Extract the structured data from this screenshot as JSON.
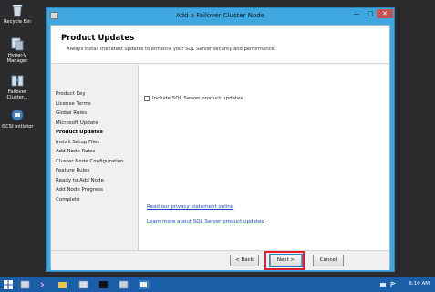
{
  "window": {
    "title": "Add a Failover Cluster Node",
    "minimize_glyph": "—",
    "maximize_glyph": "□",
    "close_glyph": "✕"
  },
  "header": {
    "title": "Product Updates",
    "subtitle": "Always install the latest updates to enhance your SQL Server security and performance."
  },
  "nav": {
    "items": [
      {
        "label": "Product Key"
      },
      {
        "label": "License Terms"
      },
      {
        "label": "Global Rules"
      },
      {
        "label": "Microsoft Update"
      },
      {
        "label": "Product Updates",
        "active": true
      },
      {
        "label": "Install Setup Files"
      },
      {
        "label": "Add Node Rules"
      },
      {
        "label": "Cluster Node Configuration"
      },
      {
        "label": "Feature Rules"
      },
      {
        "label": "Ready to Add Node"
      },
      {
        "label": "Add Node Progress"
      },
      {
        "label": "Complete"
      }
    ]
  },
  "content": {
    "checkbox_label": "Include SQL Server product updates",
    "checkbox_checked": false,
    "privacy_link": "Read our privacy statement online",
    "learn_link": "Learn more about SQL Server product updates"
  },
  "footer": {
    "back_label": "< Back",
    "next_label": "Next >",
    "cancel_label": "Cancel"
  },
  "desktop": {
    "icons": [
      {
        "label": "Recycle Bin",
        "icon": "recycle-bin-icon"
      },
      {
        "label": "Hyper-V Manager",
        "icon": "hyperv-manager-icon"
      },
      {
        "label": "Failover Cluster...",
        "icon": "failover-cluster-icon"
      },
      {
        "label": "iSCSI Initiator",
        "icon": "iscsi-initiator-icon"
      }
    ]
  },
  "taskbar": {
    "clock": "6:10 AM"
  },
  "colors": {
    "window_frame": "#3ea7e0",
    "highlight_box": "#e0212b",
    "taskbar": "#1a5ea8",
    "link": "#1a45c4"
  }
}
